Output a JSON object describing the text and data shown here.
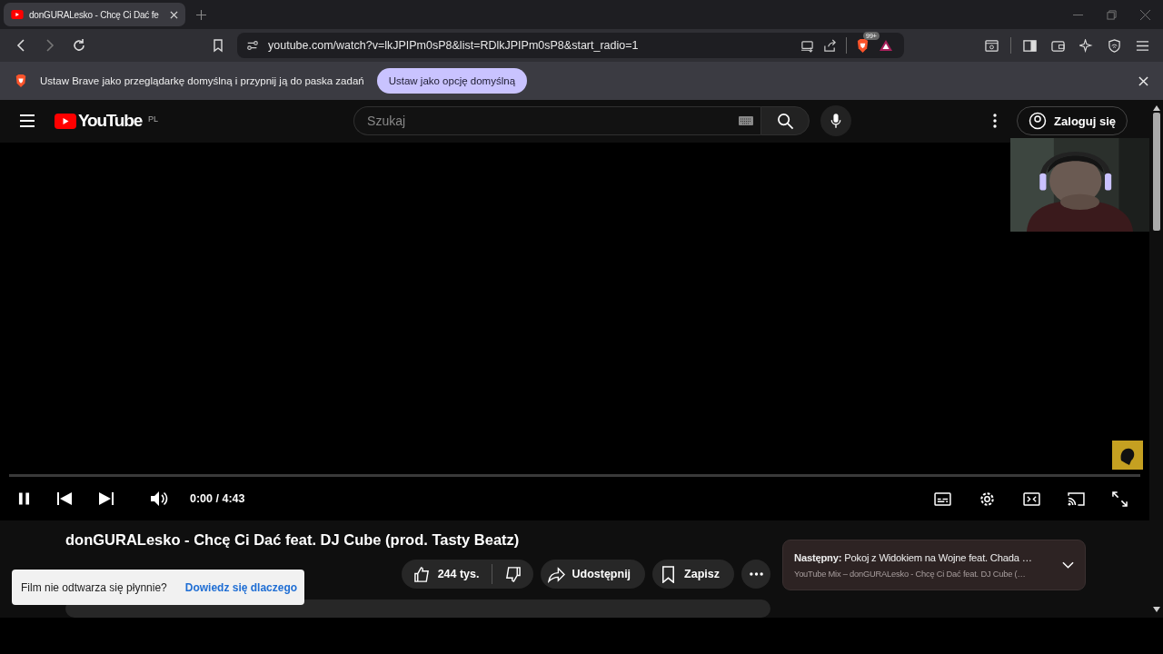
{
  "browser": {
    "tabs": [
      {
        "title": "donGURALesko - Chcę Ci Dać fe",
        "selected": true
      }
    ],
    "address": "youtube.com/watch?v=lkJPIPm0sP8&list=RDlkJPIPm0sP8&start_radio=1",
    "shields_badge": "99+"
  },
  "infobar": {
    "message": "Ustaw Brave jako przeglądarkę domyślną i przypnij ją do paska zadań",
    "button": "Ustaw jako opcję domyślną"
  },
  "youtube": {
    "logo": "YouTube",
    "region": "PL",
    "search": {
      "placeholder": "Szukaj"
    },
    "sign_in": "Zaloguj się"
  },
  "player": {
    "progress": {
      "level": 0
    },
    "playing": true,
    "time": "0:00 / 4:43"
  },
  "video": {
    "title": "donGURALesko - Chcę Ci Dać feat. DJ Cube (prod. Tasty Beatz)",
    "likes": "244 tys.",
    "share": "Udostępnij",
    "save": "Zapisz"
  },
  "toast": {
    "message": "Film nie odtwarza się płynnie?",
    "link": "Dowiedz się dlaczego"
  },
  "next_up": {
    "title": "**Następny:** Pokoj z Widokiem na Wojne feat. Chada …",
    "subtitle": "YouTube Mix – donGURALesko - Chcę Ci Dać feat. DJ Cube (…"
  }
}
